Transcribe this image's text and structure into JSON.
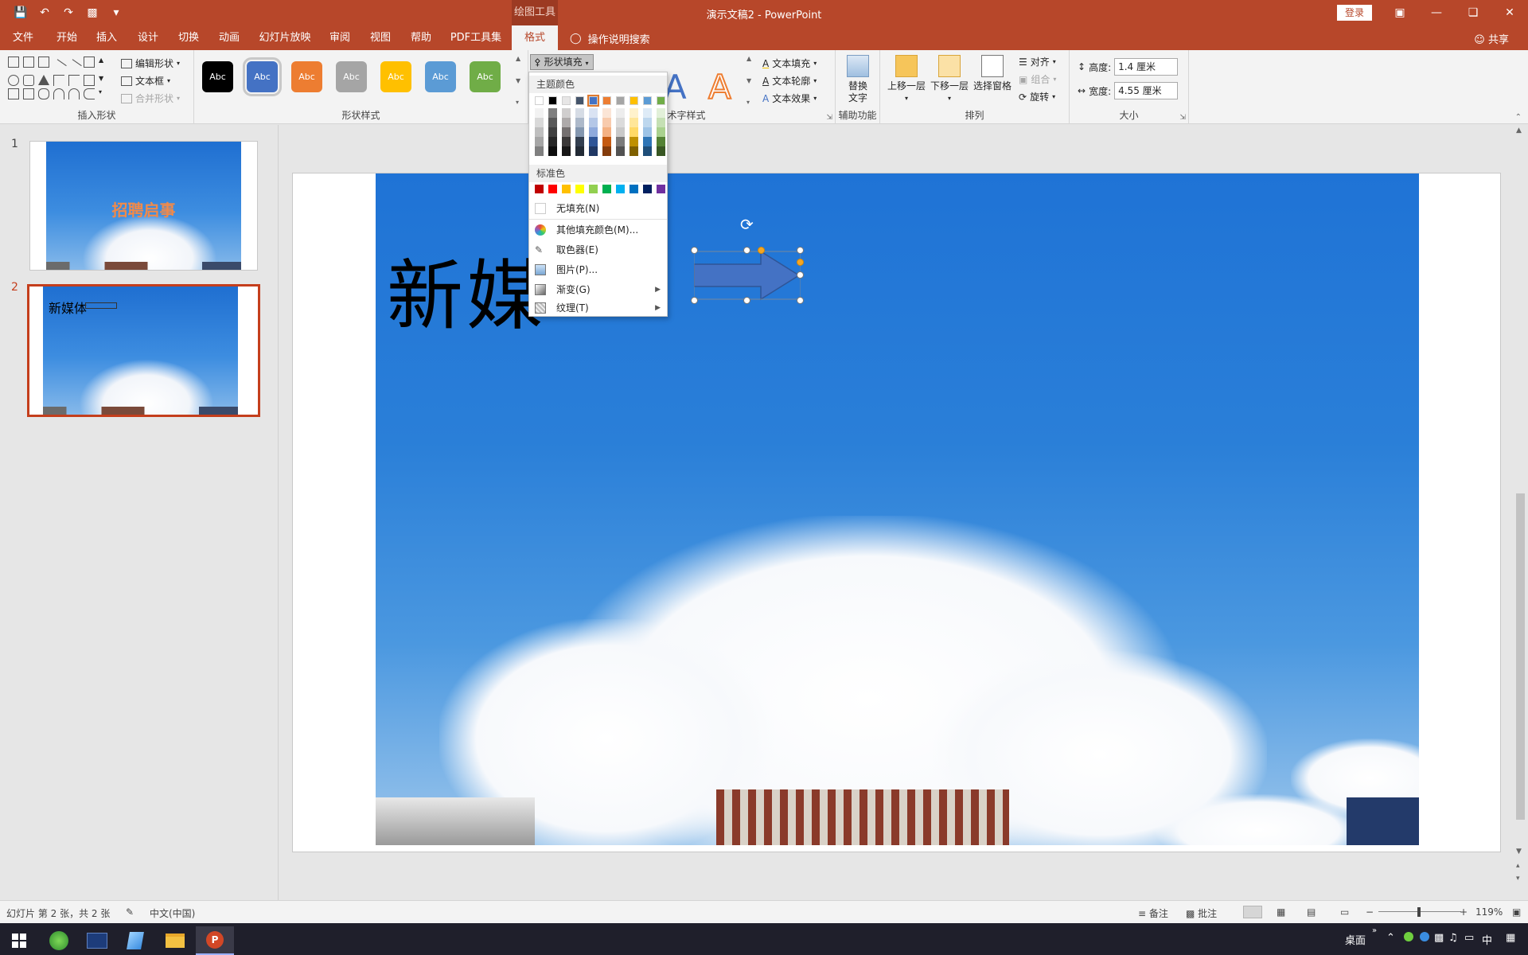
{
  "window": {
    "title": "演示文稿2 - PowerPoint",
    "context_tab_label": "绘图工具",
    "login_label": "登录",
    "controls": [
      "ribbon-display-options",
      "minimize",
      "restore",
      "close"
    ]
  },
  "tabs": [
    {
      "label": "文件",
      "active": false
    },
    {
      "label": "开始",
      "active": false
    },
    {
      "label": "插入",
      "active": false
    },
    {
      "label": "设计",
      "active": false
    },
    {
      "label": "切换",
      "active": false
    },
    {
      "label": "动画",
      "active": false
    },
    {
      "label": "幻灯片放映",
      "active": false
    },
    {
      "label": "审阅",
      "active": false
    },
    {
      "label": "视图",
      "active": false
    },
    {
      "label": "帮助",
      "active": false
    },
    {
      "label": "PDF工具集",
      "active": false
    },
    {
      "label": "格式",
      "active": true
    }
  ],
  "tell_me": "操作说明搜索",
  "share_label": "共享",
  "ribbon": {
    "insert_shapes": {
      "label": "插入形状",
      "edit_shape": "编辑形状",
      "text_box": "文本框",
      "merge_shapes": "合并形状"
    },
    "shape_styles": {
      "label": "形状样式",
      "swatch_text": "Abc",
      "swatches": [
        {
          "color": "#000000",
          "selected": false
        },
        {
          "color": "#4472c4",
          "selected": true
        },
        {
          "color": "#ed7d31",
          "selected": false
        },
        {
          "color": "#a5a5a5",
          "selected": false
        },
        {
          "color": "#ffc000",
          "selected": false
        },
        {
          "color": "#5b9bd5",
          "selected": false
        },
        {
          "color": "#70ad47",
          "selected": false
        }
      ],
      "shape_fill": "形状填充"
    },
    "wordart": {
      "label": "艺术字样式",
      "preview_letter": "A",
      "text_fill": "文本填充",
      "text_outline": "文本轮廓",
      "text_effects": "文本效果"
    },
    "accessibility": {
      "label": "辅助功能",
      "alt_text_line1": "替换",
      "alt_text_line2": "文字"
    },
    "arrange": {
      "label": "排列",
      "bring_forward": "上移一层",
      "send_backward": "下移一层",
      "selection_pane": "选择窗格",
      "align": "对齐",
      "group": "组合",
      "rotate": "旋转"
    },
    "size": {
      "label": "大小",
      "height_label": "高度:",
      "height_value": "1.4 厘米",
      "width_label": "宽度:",
      "width_value": "4.55 厘米"
    }
  },
  "shape_fill_menu": {
    "theme_colors_label": "主题颜色",
    "standard_colors_label": "标准色",
    "theme_columns": [
      [
        "#ffffff",
        "#f2f2f2",
        "#d9d9d9",
        "#bfbfbf",
        "#a6a6a6",
        "#808080"
      ],
      [
        "#000000",
        "#7f7f7f",
        "#595959",
        "#404040",
        "#262626",
        "#0d0d0d"
      ],
      [
        "#e7e6e6",
        "#d0cece",
        "#aeaaaa",
        "#757070",
        "#3b3838",
        "#171616"
      ],
      [
        "#44546a",
        "#d6dce5",
        "#adb9ca",
        "#8497b0",
        "#333f50",
        "#222a35"
      ],
      [
        "#4472c4",
        "#dae3f3",
        "#b4c7e7",
        "#8faadc",
        "#2f5597",
        "#203864"
      ],
      [
        "#ed7d31",
        "#fbe5d6",
        "#f8cbad",
        "#f4b183",
        "#c55a11",
        "#843c0c"
      ],
      [
        "#a5a5a5",
        "#ededed",
        "#dbdbdb",
        "#c9c9c9",
        "#7b7b7b",
        "#525252"
      ],
      [
        "#ffc000",
        "#fff2cc",
        "#ffe699",
        "#ffd966",
        "#bf9000",
        "#7f6000"
      ],
      [
        "#5b9bd5",
        "#deebf7",
        "#bdd7ee",
        "#9dc3e6",
        "#2e75b6",
        "#1f4e79"
      ],
      [
        "#70ad47",
        "#e2f0d9",
        "#c5e0b4",
        "#a9d18e",
        "#548235",
        "#385723"
      ]
    ],
    "standard_colors": [
      "#c00000",
      "#ff0000",
      "#ffc000",
      "#ffff00",
      "#92d050",
      "#00b050",
      "#00b0f0",
      "#0070c0",
      "#002060",
      "#7030a0"
    ],
    "no_fill": "无填充(N)",
    "more_colors": "其他填充颜色(M)...",
    "eyedropper": "取色器(E)",
    "picture": "图片(P)...",
    "gradient": "渐变(G)",
    "texture": "纹理(T)"
  },
  "slides": [
    {
      "number": "1",
      "title": "招聘启事",
      "selected": false
    },
    {
      "number": "2",
      "title": "新媒体",
      "selected": true
    }
  ],
  "slide_canvas": {
    "title_text": "新媒"
  },
  "status": {
    "slide_info": "幻灯片 第 2 张，共 2 张",
    "language": "中文(中国)",
    "notes": "备注",
    "comments": "批注",
    "zoom": "119%"
  },
  "taskbar": {
    "desktop_label": "桌面",
    "ime_label": "中"
  }
}
